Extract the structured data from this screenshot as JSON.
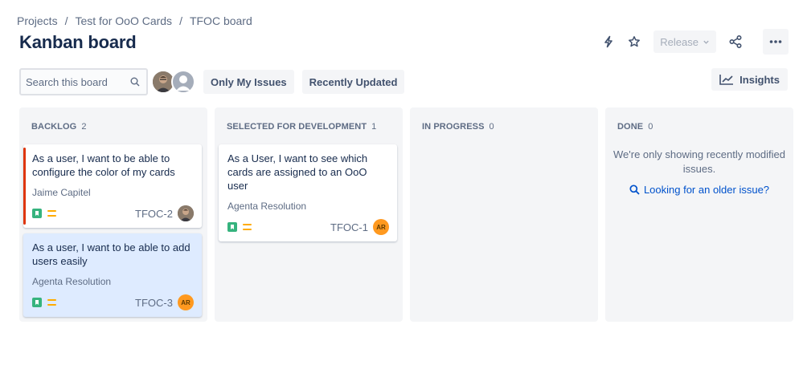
{
  "breadcrumb": {
    "items": [
      "Projects",
      "Test for OoO Cards",
      "TFOC board"
    ],
    "separator": "/"
  },
  "page_title": "Kanban board",
  "toolbar": {
    "release_label": "Release",
    "icons": [
      "lightning-icon",
      "star-icon",
      "share-icon",
      "more-icon"
    ]
  },
  "search": {
    "placeholder": "Search this board",
    "value": ""
  },
  "filters": {
    "only_my_issues": "Only My Issues",
    "recently_updated": "Recently Updated"
  },
  "insights_label": "Insights",
  "columns": [
    {
      "title": "BACKLOG",
      "count": "2"
    },
    {
      "title": "SELECTED FOR DEVELOPMENT",
      "count": "1"
    },
    {
      "title": "IN PROGRESS",
      "count": "0"
    },
    {
      "title": "DONE",
      "count": "0"
    }
  ],
  "cards": [
    {
      "summary": "As a user, I want to be able to configure the color of my cards",
      "assignee": "Jaime Capitel",
      "key": "TFOC-2",
      "avatar": "photo",
      "flagged": true,
      "flag_color": "#de350b"
    },
    {
      "summary": "As a user, I want to be able to add users easily",
      "assignee": "Agenta Resolution",
      "key": "TFOC-3",
      "avatar": "AR",
      "selected": true
    },
    {
      "summary": "As a User, I want to see which cards are assigned to an OoO user",
      "assignee": "Agenta Resolution",
      "key": "TFOC-1",
      "avatar": "AR"
    }
  ],
  "done": {
    "empty_message": "We're only showing recently modified issues.",
    "link": "Looking for an older issue?"
  },
  "colors": {
    "story": "#36b37e",
    "priority_medium": "#ffab00",
    "avatar_ar": "#ff991f",
    "link": "#0052cc",
    "column_bg": "#f4f5f7",
    "selected_card": "#deebff"
  }
}
